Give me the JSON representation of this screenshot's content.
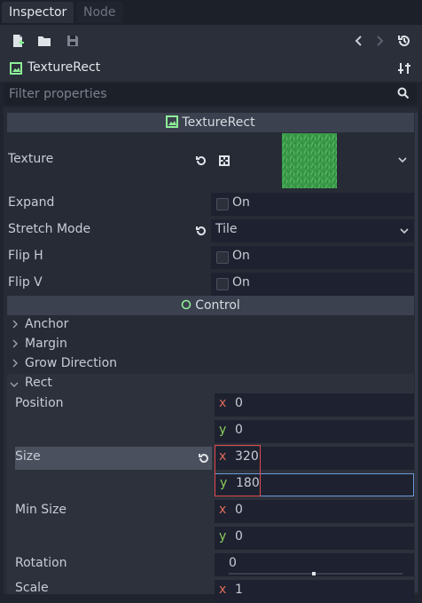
{
  "tabs": {
    "inspector": "Inspector",
    "node": "Node"
  },
  "object": {
    "name": "TextureRect"
  },
  "filter": {
    "placeholder": "Filter properties"
  },
  "sections": {
    "texture_rect": "TextureRect",
    "control": "Control"
  },
  "properties": {
    "texture": "Texture",
    "expand": "Expand",
    "expand_value": "On",
    "stretch_mode": "Stretch Mode",
    "stretch_mode_value": "Tile",
    "flip_h": "Flip H",
    "flip_h_value": "On",
    "flip_v": "Flip V",
    "flip_v_value": "On"
  },
  "groups": {
    "anchor": "Anchor",
    "margin": "Margin",
    "grow_direction": "Grow Direction",
    "rect": "Rect"
  },
  "rect": {
    "position": "Position",
    "position_x": "0",
    "position_y": "0",
    "size": "Size",
    "size_x": "320",
    "size_y": "180",
    "min_size": "Min Size",
    "min_size_x": "0",
    "min_size_y": "0",
    "rotation": "Rotation",
    "rotation_value": "0",
    "scale": "Scale",
    "scale_x": "1"
  },
  "axis": {
    "x": "x",
    "y": "y"
  },
  "colors": {
    "accent_green": "#8eef97",
    "texture_green": "#3a9a4a",
    "axis_x": "#e06a5a",
    "axis_y": "#8acc5c",
    "highlight_border": "#e04a4a",
    "focus_border": "#6f9bd8"
  }
}
